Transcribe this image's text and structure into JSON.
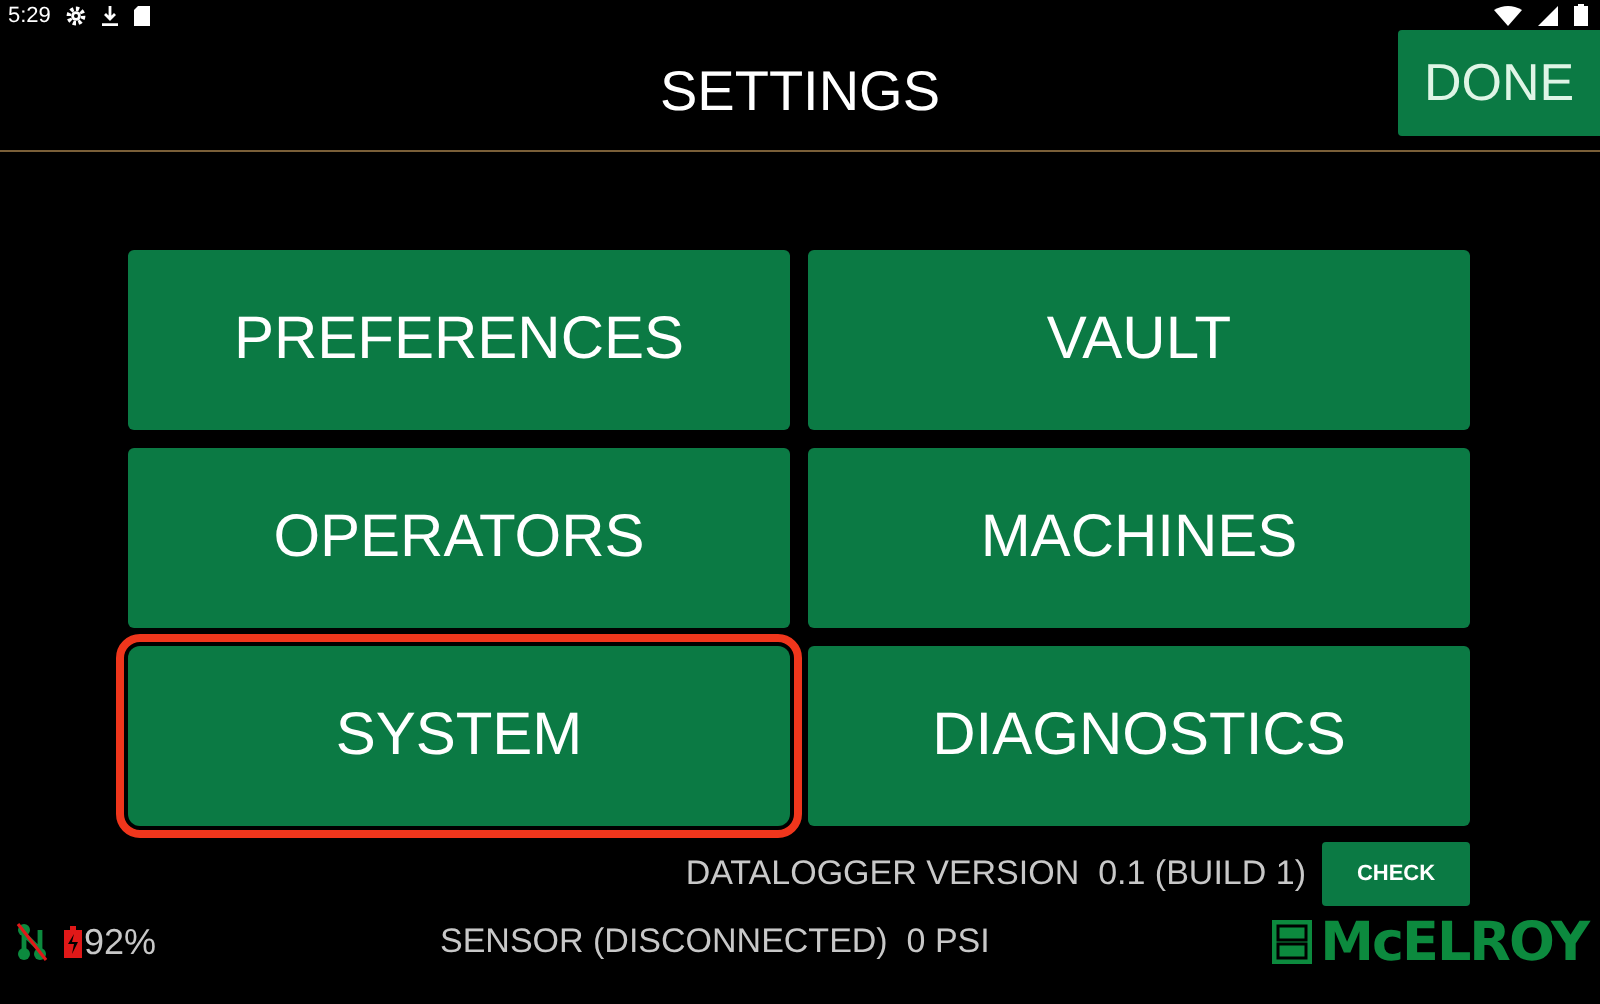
{
  "status_bar": {
    "time": "5:29"
  },
  "header": {
    "title": "SETTINGS",
    "done_label": "DONE"
  },
  "menu": [
    {
      "label": "PREFERENCES",
      "selected": false
    },
    {
      "label": "VAULT",
      "selected": false
    },
    {
      "label": "OPERATORS",
      "selected": false
    },
    {
      "label": "MACHINES",
      "selected": false
    },
    {
      "label": "SYSTEM",
      "selected": true
    },
    {
      "label": "DIAGNOSTICS",
      "selected": false
    }
  ],
  "version": {
    "text": "DATALOGGER VERSION  0.1 (BUILD 1)",
    "button": "CHECK"
  },
  "footer": {
    "battery": "92%",
    "sensor": "SENSOR (DISCONNECTED)  0 PSI",
    "logo": "McELROY"
  }
}
